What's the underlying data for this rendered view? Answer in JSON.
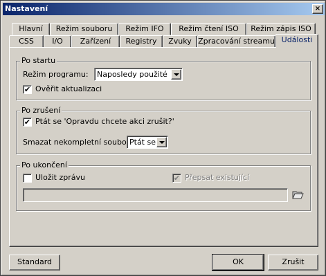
{
  "window": {
    "title": "Nastavení",
    "close_glyph": "×"
  },
  "tabs_row1": [
    {
      "label": "Hlavní"
    },
    {
      "label": "Režim souboru"
    },
    {
      "label": "Režim IFO"
    },
    {
      "label": "Režim čtení ISO"
    },
    {
      "label": "Režim zápis ISO"
    }
  ],
  "tabs_row2": [
    {
      "label": "CSS"
    },
    {
      "label": "I/O"
    },
    {
      "label": "Zařízení"
    },
    {
      "label": "Registry"
    },
    {
      "label": "Zvuky"
    },
    {
      "label": "Zpracování streamu"
    },
    {
      "label": "Události",
      "active": true
    }
  ],
  "group_start": {
    "title": "Po startu",
    "mode_label": "Režim programu:",
    "mode_value": "Naposledy použité",
    "check_updates_label": "Ověřit aktualizaci",
    "check_updates_checked": true
  },
  "group_cancel": {
    "title": "Po zrušení",
    "ask_label": "Ptát se 'Opravdu chcete akci zrušit?'",
    "ask_checked": true,
    "delete_label": "Smazat nekompletní soubory:",
    "delete_value": "Ptát se"
  },
  "group_finish": {
    "title": "Po ukončení",
    "save_report_label": "Uložit zprávu",
    "save_report_checked": false,
    "overwrite_label": "Přepsat existující",
    "overwrite_checked": true,
    "overwrite_enabled": false,
    "path_value": ""
  },
  "buttons": {
    "standard": "Standard",
    "ok": "OK",
    "cancel": "Zrušit"
  },
  "check_glyph": "✔",
  "colors": {
    "titlebar_start": "#0a246a",
    "titlebar_end": "#a6caf0",
    "face": "#d4d0c8",
    "active_tab_text": "#0a246a"
  }
}
